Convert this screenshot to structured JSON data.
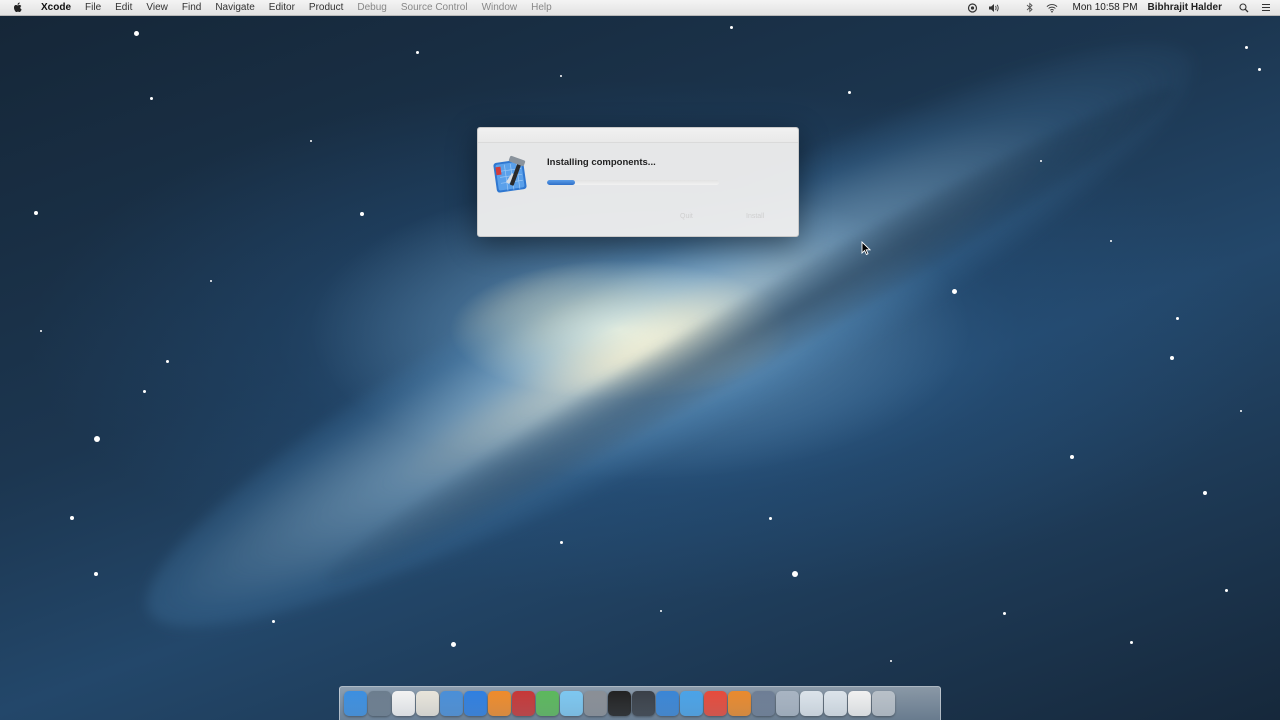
{
  "menubar": {
    "items": [
      {
        "label": "Xcode"
      },
      {
        "label": "File"
      },
      {
        "label": "Edit"
      },
      {
        "label": "View"
      },
      {
        "label": "Find"
      },
      {
        "label": "Navigate"
      },
      {
        "label": "Editor"
      },
      {
        "label": "Product"
      },
      {
        "label": "Debug"
      },
      {
        "label": "Source Control"
      },
      {
        "label": "Window"
      },
      {
        "label": "Help"
      }
    ],
    "status": {
      "clock": "Mon 10:58 PM",
      "user": "Bibhrajit Halder"
    }
  },
  "dialog": {
    "message": "Installing components...",
    "progress": 0.16,
    "buttons": {
      "cancel": "Quit",
      "next": "Install"
    }
  },
  "dock": {
    "icons": [
      {
        "name": "finder",
        "color": "#3c8fe0"
      },
      {
        "name": "launchpad",
        "color": "#6c7d8e"
      },
      {
        "name": "calendar",
        "color": "#f2f2f2"
      },
      {
        "name": "textedit",
        "color": "#e8e4da"
      },
      {
        "name": "itunes",
        "color": "#4a8fd8"
      },
      {
        "name": "app-store",
        "color": "#2f7fe0"
      },
      {
        "name": "ibooks",
        "color": "#ef8b2b"
      },
      {
        "name": "photo-booth",
        "color": "#c63838"
      },
      {
        "name": "maps",
        "color": "#5cb85c"
      },
      {
        "name": "messages",
        "color": "#7dc7f0"
      },
      {
        "name": "system-preferences",
        "color": "#8a8f96"
      },
      {
        "name": "terminal",
        "color": "#222222"
      },
      {
        "name": "activity-monitor",
        "color": "#3a4048"
      },
      {
        "name": "xcode",
        "color": "#3a86d6"
      },
      {
        "name": "safari",
        "color": "#4aa3e8"
      },
      {
        "name": "chrome",
        "color": "#e64b3c"
      },
      {
        "name": "firefox",
        "color": "#e98a2d"
      },
      {
        "name": "instruments",
        "color": "#6e7e95"
      },
      {
        "name": "simulator",
        "color": "#a8b4c2"
      },
      {
        "name": "documents-folder",
        "color": "#dbe3ea"
      },
      {
        "name": "downloads-folder",
        "color": "#dbe3ea"
      },
      {
        "name": "stack",
        "color": "#f0f0f0"
      },
      {
        "name": "trash",
        "color": "#b8c0c8"
      }
    ]
  }
}
